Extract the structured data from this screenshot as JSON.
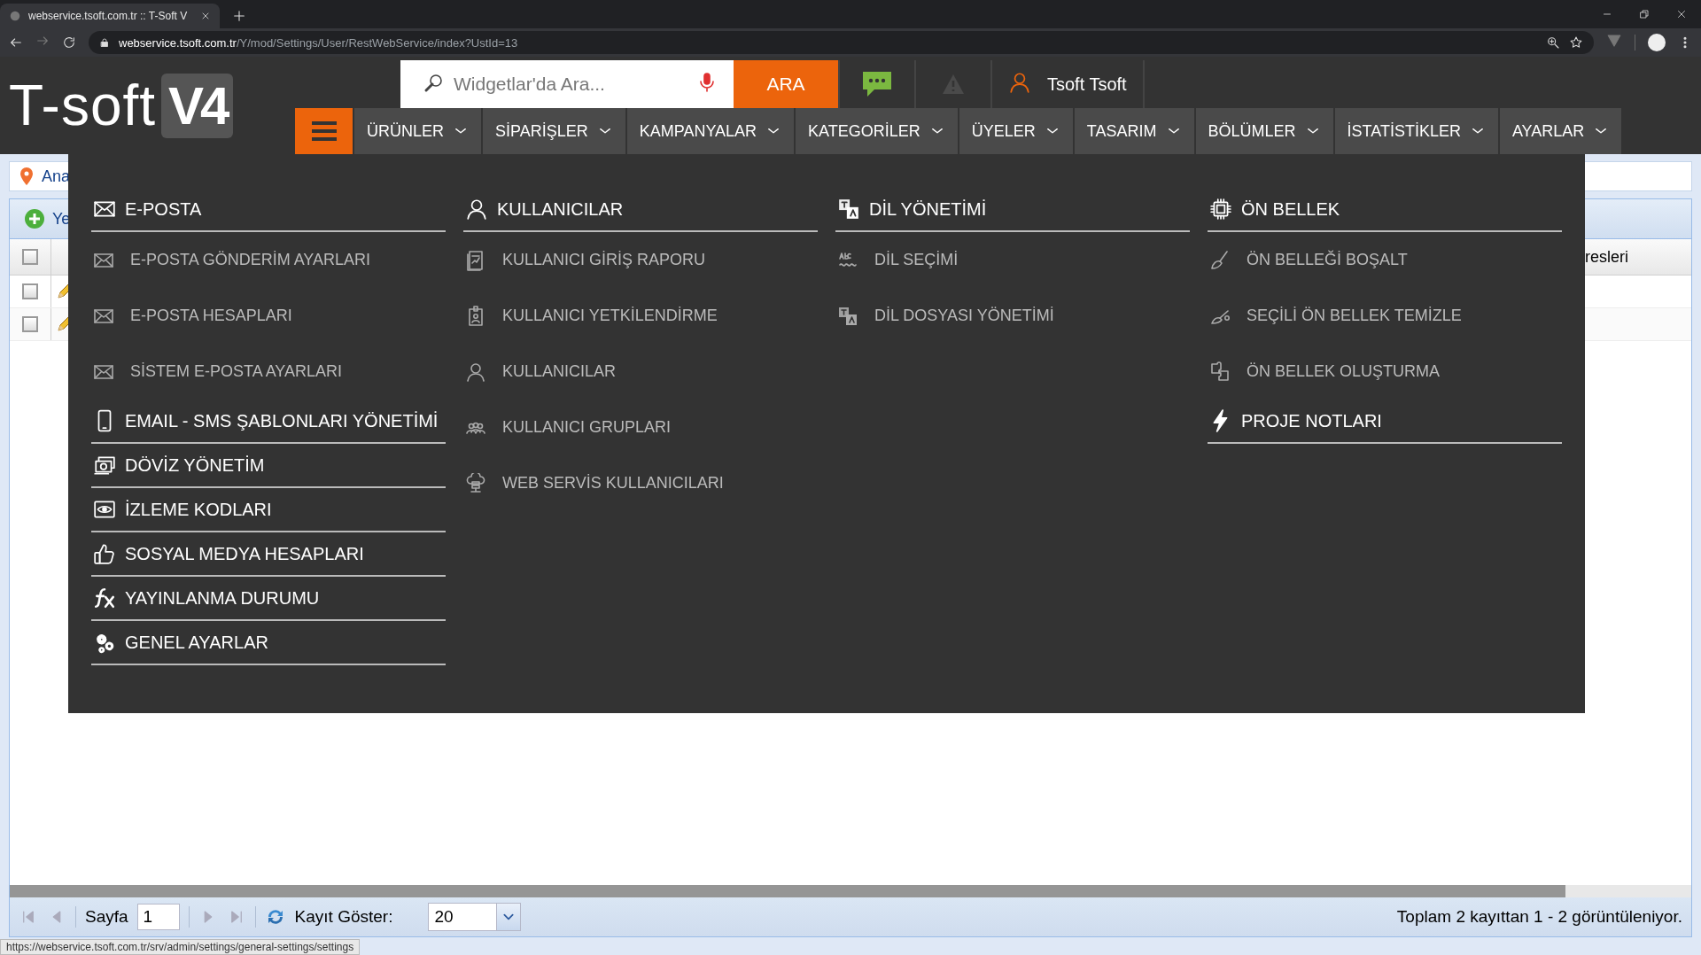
{
  "browser": {
    "tab_title": "webservice.tsoft.com.tr :: T-Soft V",
    "url_host": "webservice.tsoft.com.tr",
    "url_path": "/Y/mod/Settings/User/RestWebService/index?UstId=13"
  },
  "logo": {
    "name": "T-soft",
    "version": "V4"
  },
  "search": {
    "placeholder": "Widgetlar'da Ara...",
    "button": "ARA"
  },
  "user": {
    "name": "Tsoft Tsoft"
  },
  "menu_button": {
    "open": true
  },
  "nav": [
    {
      "label": "ÜRÜNLER",
      "selected": false
    },
    {
      "label": "SİPARİŞLER",
      "selected": false
    },
    {
      "label": "KAMPANYALAR",
      "selected": false
    },
    {
      "label": "KATEGORİLER",
      "selected": false
    },
    {
      "label": "ÜYELER",
      "selected": false
    },
    {
      "label": "TASARIM",
      "selected": false
    },
    {
      "label": "BÖLÜMLER",
      "selected": false
    },
    {
      "label": "İSTATİSTİKLER",
      "selected": false
    },
    {
      "label": "AYARLAR",
      "selected": false
    }
  ],
  "menu": {
    "columns": [
      {
        "groups": [
          {
            "title": "E-POSTA",
            "items": [
              "E-POSTA GÖNDERİM AYARLARI",
              "E-POSTA HESAPLARI",
              "SİSTEM E-POSTA AYARLARI"
            ]
          },
          {
            "title": "EMAIL - SMS ŞABLONLARI YÖNETİMİ"
          },
          {
            "title": "DÖVİZ YÖNETİM"
          },
          {
            "title": "İZLEME KODLARI"
          },
          {
            "title": "SOSYAL MEDYA HESAPLARI"
          },
          {
            "title": "YAYINLANMA DURUMU"
          },
          {
            "title": "GENEL AYARLAR"
          }
        ]
      },
      {
        "groups": [
          {
            "title": "KULLANICILAR",
            "items": [
              "KULLANICI GİRİŞ RAPORU",
              "KULLANICI YETKİLENDİRME",
              "KULLANICILAR",
              "KULLANICI GRUPLARI",
              "WEB SERVİS KULLANICILARI"
            ]
          }
        ]
      },
      {
        "groups": [
          {
            "title": "DİL YÖNETİMİ",
            "items": [
              "DİL SEÇİMİ",
              "DİL DOSYASI YÖNETİMİ"
            ]
          }
        ]
      },
      {
        "groups": [
          {
            "title": "ÖN BELLEK",
            "items": [
              "ÖN BELLEĞİ BOŞALT",
              "SEÇİLİ ÖN BELLEK TEMİZLE",
              "ÖN BELLEK OLUŞTURMA"
            ]
          },
          {
            "title": "PROJE NOTLARI"
          }
        ]
      }
    ]
  },
  "breadcrumb": "Ana",
  "toolbar": {
    "add_button": "Ye"
  },
  "grid": {
    "column_header": "resleri",
    "rows": [
      {
        "checked": false
      },
      {
        "checked": false
      }
    ],
    "header_checked": false
  },
  "pager": {
    "page_label": "Sayfa",
    "page": "1",
    "page_size_label": "Kayıt Göster:",
    "page_size": "20",
    "summary": "Toplam 2 kayıttan 1 - 2 görüntüleniyor."
  },
  "status_url": "https://webservice.tsoft.com.tr/srv/admin/settings/general-settings/settings"
}
